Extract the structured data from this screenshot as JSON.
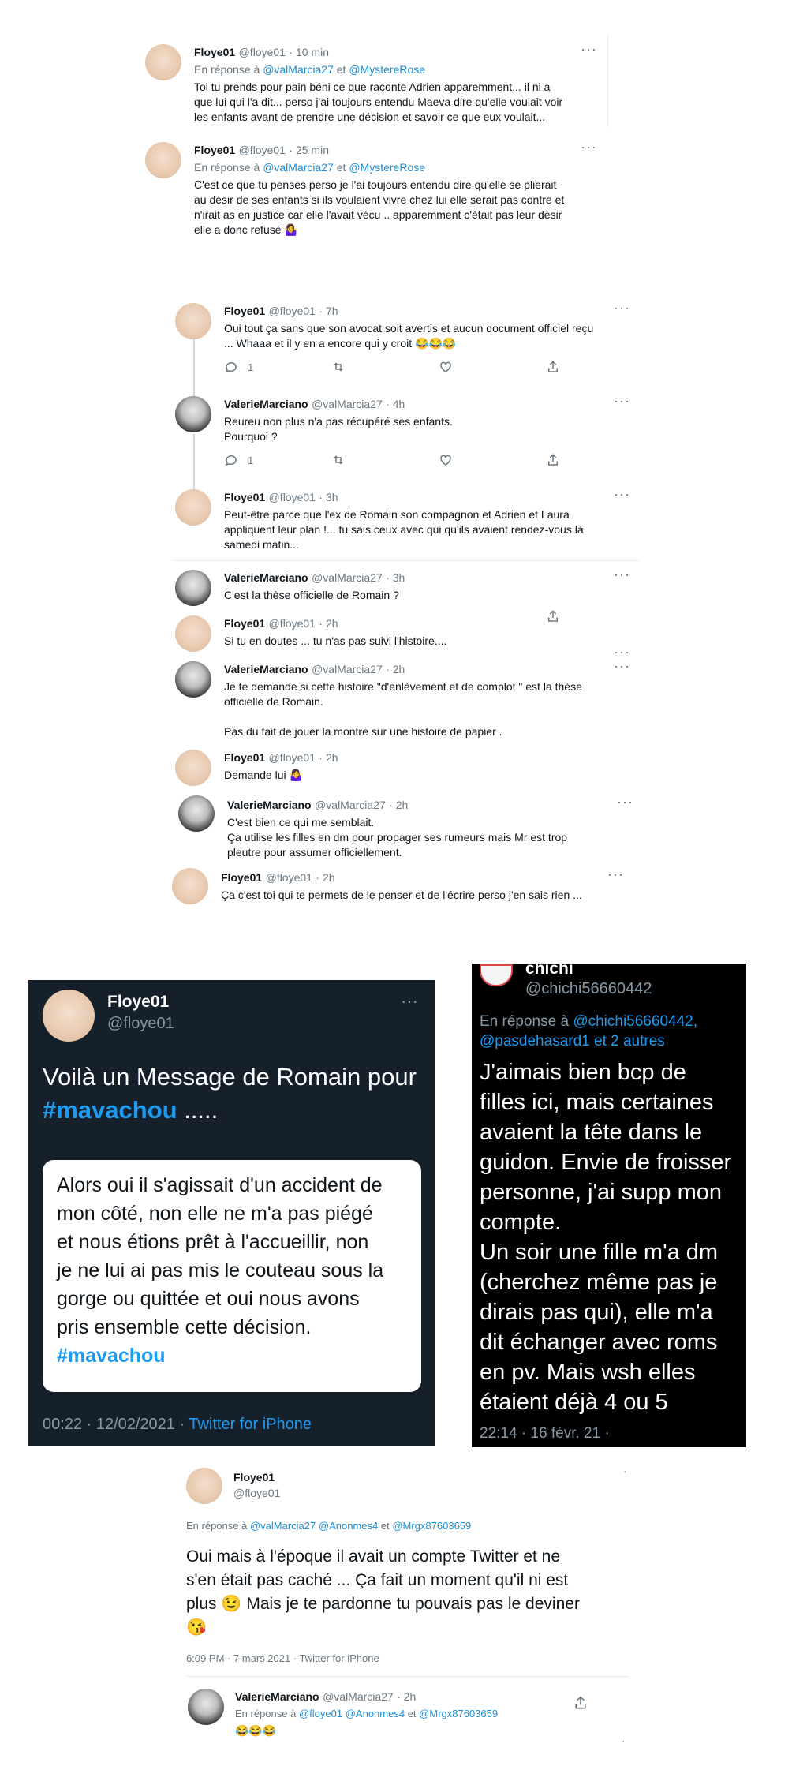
{
  "section1": {
    "tweets": [
      {
        "name": "Floye01",
        "handle": "@floye01",
        "time": "· 10 min",
        "reply_prefix": "En réponse à",
        "reply_users": [
          "@valMarcia27",
          "et",
          "@MystereRose"
        ],
        "lines": [
          "Toi tu prends pour pain béni ce que raconte Adrien apparemment... il ni a",
          "que lui qui l'a dit... perso j'ai toujours entendu Maeva dire qu'elle voulait voir",
          "les enfants avant de prendre une décision et savoir ce que eux voulait..."
        ]
      },
      {
        "name": "Floye01",
        "handle": "@floye01",
        "time": "· 25 min",
        "reply_prefix": "En réponse à",
        "reply_users": [
          "@valMarcia27",
          "et",
          "@MystereRose"
        ],
        "lines": [
          "C'est ce que tu penses perso je l'ai toujours entendu dire qu'elle se plierait",
          "au désir de ses enfants si ils voulaient vivre chez lui elle serait pas contre et",
          "n'irait as en justice car elle l'avait vécu .. apparemment c'était pas leur désir",
          "elle a donc refusé 🤷‍♀️"
        ]
      }
    ]
  },
  "section2": {
    "tweets": [
      {
        "name": "Floye01",
        "handle": "@floye01",
        "time": "· 7h",
        "lines": [
          "Oui tout ça sans que son avocat soit avertis et aucun document officiel reçu",
          "... Whaaa et il y en a encore qui y croit 😂😂😂"
        ],
        "reply_count": "1"
      },
      {
        "name": "ValerieMarciano",
        "handle": "@valMarcia27",
        "time": "· 4h",
        "lines": [
          "Reureu non plus n'a pas récupéré ses enfants.",
          "Pourquoi ?"
        ],
        "reply_count": "1"
      },
      {
        "name": "Floye01",
        "handle": "@floye01",
        "time": "· 3h",
        "lines": [
          "Peut-être parce que l'ex de Romain son compagnon et Adrien et Laura",
          "appliquent leur plan !... tu sais ceux avec qui qu'ils avaient rendez-vous là",
          "samedi matin..."
        ]
      },
      {
        "name": "ValerieMarciano",
        "handle": "@valMarcia27",
        "time": "· 3h",
        "lines": [
          "C'est la thèse officielle de Romain ?"
        ]
      },
      {
        "name": "Floye01",
        "handle": "@floye01",
        "time": "· 2h",
        "lines": [
          "Si tu en doutes ... tu n'as pas suivi l'histoire...."
        ]
      },
      {
        "name": "ValerieMarciano",
        "handle": "@valMarcia27",
        "time": "· 2h",
        "lines": [
          "Je te demande si cette histoire \"d'enlèvement et de complot \" est la thèse",
          "officielle de Romain.",
          "",
          "Pas du fait de jouer la montre sur une histoire de papier ."
        ]
      },
      {
        "name": "Floye01",
        "handle": "@floye01",
        "time": "· 2h",
        "lines": [
          "Demande lui 🤷‍♀️"
        ]
      },
      {
        "name": "ValerieMarciano",
        "handle": "@valMarcia27",
        "time": "· 2h",
        "lines": [
          "C'est bien ce qui me semblait.",
          "Ça utilise les filles en dm pour propager ses rumeurs mais Mr est trop",
          "pleutre pour assumer officiellement."
        ]
      },
      {
        "name": "Floye01",
        "handle": "@floye01",
        "time": "· 2h",
        "lines": [
          "Ça c'est toi qui te permets de le penser et de l'écrire perso j'en sais rien ..."
        ]
      }
    ]
  },
  "card1": {
    "name": "Floye01",
    "handle": "@floye01",
    "text_line1": "Voilà un Message de Romain pour",
    "hashtag1": "#mavachou",
    "text_suffix": ".....",
    "quote_lines": [
      "Alors oui il s'agissait d'un accident de",
      "mon côté, non elle ne m'a pas piégé",
      "et nous étions prêt à l'accueillir, non",
      "je ne lui ai pas mis le couteau sous la",
      "gorge ou quittée et oui nous avons",
      "pris ensemble cette décision."
    ],
    "hashtag2": "#mavachou",
    "time": "00:22 · 12/02/2021 ·",
    "client": "Twitter for iPhone"
  },
  "card2": {
    "name": "chichi",
    "handle": "@chichi56660442",
    "reply_prefix": "En réponse à",
    "reply_users_1": "@chichi56660442,",
    "reply_users_2": "@pasdehasard1 et 2 autres",
    "lines": [
      "J'aimais bien bcp de",
      "filles ici, mais certaines",
      "avaient la tête dans le",
      "guidon. Envie de froisser",
      "personne, j'ai supp mon",
      "compte.",
      "Un soir une fille m'a dm",
      "(cherchez même pas je",
      "dirais pas qui), elle m'a",
      "dit échanger avec roms",
      "en pv. Mais wsh elles",
      "étaient déjà 4 ou 5"
    ],
    "time": "22:14 · 16 févr. 21 ·"
  },
  "section3": {
    "name": "Floye01",
    "handle": "@floye01",
    "reply_prefix": "En réponse à",
    "reply_users": [
      "@valMarcia27",
      "@Anonmes4",
      "et",
      "@Mrgx87603659"
    ],
    "lines": [
      "Oui mais à l'époque il avait un compte Twitter et ne",
      "s'en était pas caché ... Ça fait un moment qu'il ni est",
      "plus 😉 Mais je te pardonne tu pouvais pas le deviner",
      "😘"
    ],
    "meta": "6:09 PM · 7 mars 2021 · Twitter for iPhone",
    "reply": {
      "name": "ValerieMarciano",
      "handle": "@valMarcia27",
      "time": "· 2h",
      "reply_prefix": "En réponse à",
      "reply_users": [
        "@floye01",
        "@Anonmes4",
        "et",
        "@Mrgx87603659"
      ],
      "text": "😂😂😂"
    }
  }
}
